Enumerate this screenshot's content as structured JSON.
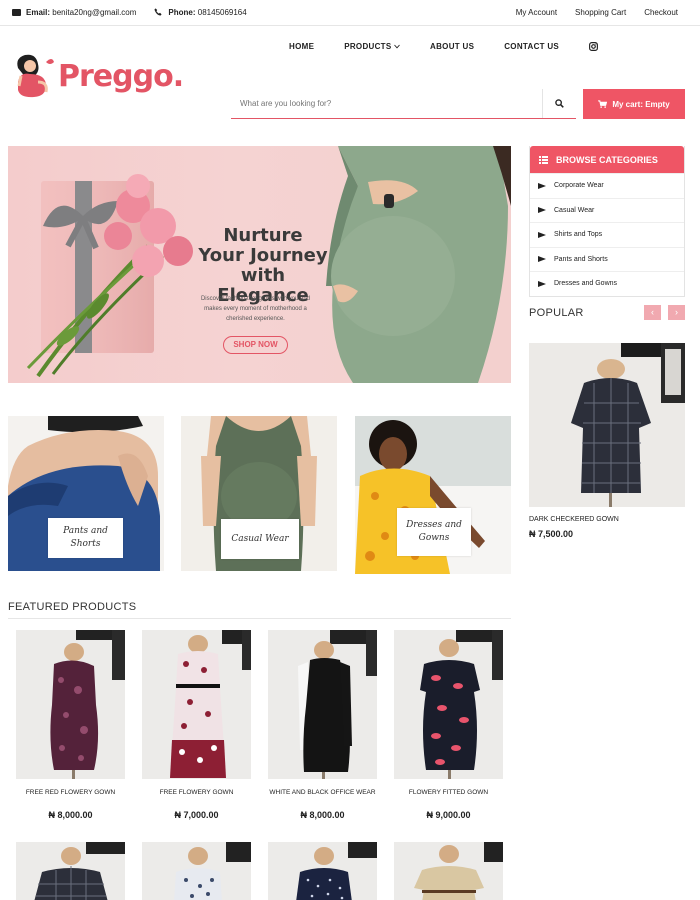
{
  "topbar": {
    "email_label": "Email:",
    "email": "benita20ng@gmail.com",
    "phone_label": "Phone:",
    "phone": "08145069164",
    "links": [
      "My Account",
      "Shopping Cart",
      "Checkout"
    ]
  },
  "brand": {
    "name": "Preggo.",
    "accent": "#ef5565"
  },
  "nav": [
    "HOME",
    "PRODUCTS",
    "ABOUT US",
    "CONTACT US"
  ],
  "search": {
    "placeholder": "What are you looking for?"
  },
  "cart": {
    "label": "My cart: Empty"
  },
  "hero": {
    "title": "Nurture Your Journey with Elegance",
    "subtitle": "Discover fashion that grows with you and makes every moment of motherhood a cherished experience.",
    "button": "SHOP NOW"
  },
  "categories": {
    "title": "BROWSE CATEGORIES",
    "items": [
      "Corporate Wear",
      "Casual Wear",
      "Shirts and Tops",
      "Pants and Shorts",
      "Dresses and Gowns"
    ]
  },
  "popular": {
    "title": "POPULAR",
    "prev": "‹",
    "next": "›",
    "item": {
      "name": "DARK CHECKERED GOWN",
      "price": "₦ 7,500.00"
    }
  },
  "tiles": [
    {
      "label": "Pants and Shorts"
    },
    {
      "label": "Casual Wear"
    },
    {
      "label": "Dresses and Gowns"
    }
  ],
  "featured": {
    "title": "FEATURED PRODUCTS",
    "products": [
      {
        "name": "FREE RED FLOWERY GOWN",
        "price": "₦ 8,000.00"
      },
      {
        "name": "FREE FLOWERY GOWN",
        "price": "₦ 7,000.00"
      },
      {
        "name": "WHITE AND BLACK OFFICE WEAR",
        "price": "₦ 8,000.00"
      },
      {
        "name": "FLOWERY FITTED GOWN",
        "price": "₦ 9,000.00"
      }
    ]
  }
}
